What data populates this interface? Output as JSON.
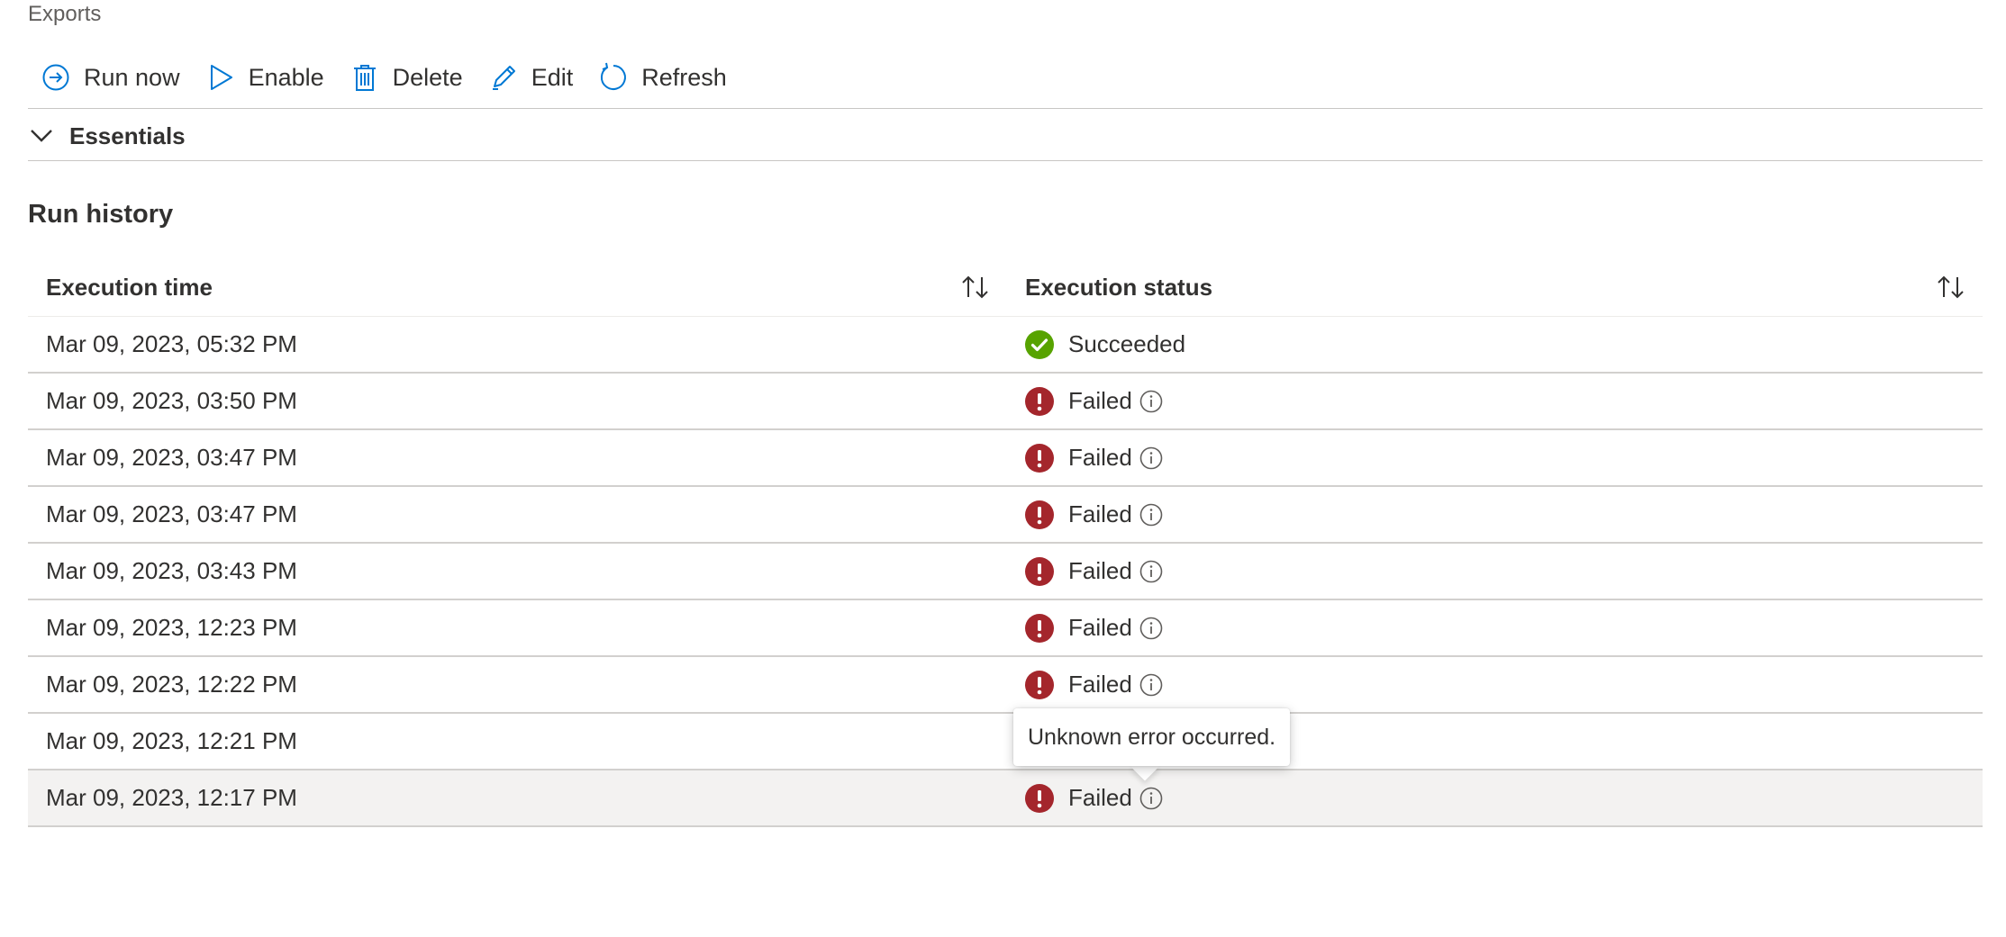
{
  "breadcrumb": "Exports",
  "toolbar": {
    "run_now": "Run now",
    "enable": "Enable",
    "delete": "Delete",
    "edit": "Edit",
    "refresh": "Refresh"
  },
  "essentials": {
    "label": "Essentials"
  },
  "run_history": {
    "title": "Run history",
    "columns": [
      "Execution time",
      "Execution status"
    ],
    "rows": [
      {
        "time": "Mar 09, 2023, 05:32 PM",
        "status": "Succeeded"
      },
      {
        "time": "Mar 09, 2023, 03:50 PM",
        "status": "Failed"
      },
      {
        "time": "Mar 09, 2023, 03:47 PM",
        "status": "Failed"
      },
      {
        "time": "Mar 09, 2023, 03:47 PM",
        "status": "Failed"
      },
      {
        "time": "Mar 09, 2023, 03:43 PM",
        "status": "Failed"
      },
      {
        "time": "Mar 09, 2023, 12:23 PM",
        "status": "Failed"
      },
      {
        "time": "Mar 09, 2023, 12:22 PM",
        "status": "Failed"
      },
      {
        "time": "Mar 09, 2023, 12:21 PM",
        "status": ""
      },
      {
        "time": "Mar 09, 2023, 12:17 PM",
        "status": "Failed"
      }
    ]
  },
  "tooltip": {
    "text": "Unknown error occurred."
  },
  "colors": {
    "accent": "#0078d4",
    "success": "#57a300",
    "error": "#a4262c",
    "selected_row": "#f3f2f1"
  },
  "icons": {
    "run_now": "circle-arrow-right-icon",
    "enable": "play-icon",
    "delete": "trash-icon",
    "edit": "pencil-icon",
    "refresh": "refresh-icon",
    "essentials": "chevron-down-icon",
    "sort": "sort-icon",
    "succeeded": "check-circle-icon",
    "failed": "error-circle-icon",
    "info": "info-icon"
  }
}
